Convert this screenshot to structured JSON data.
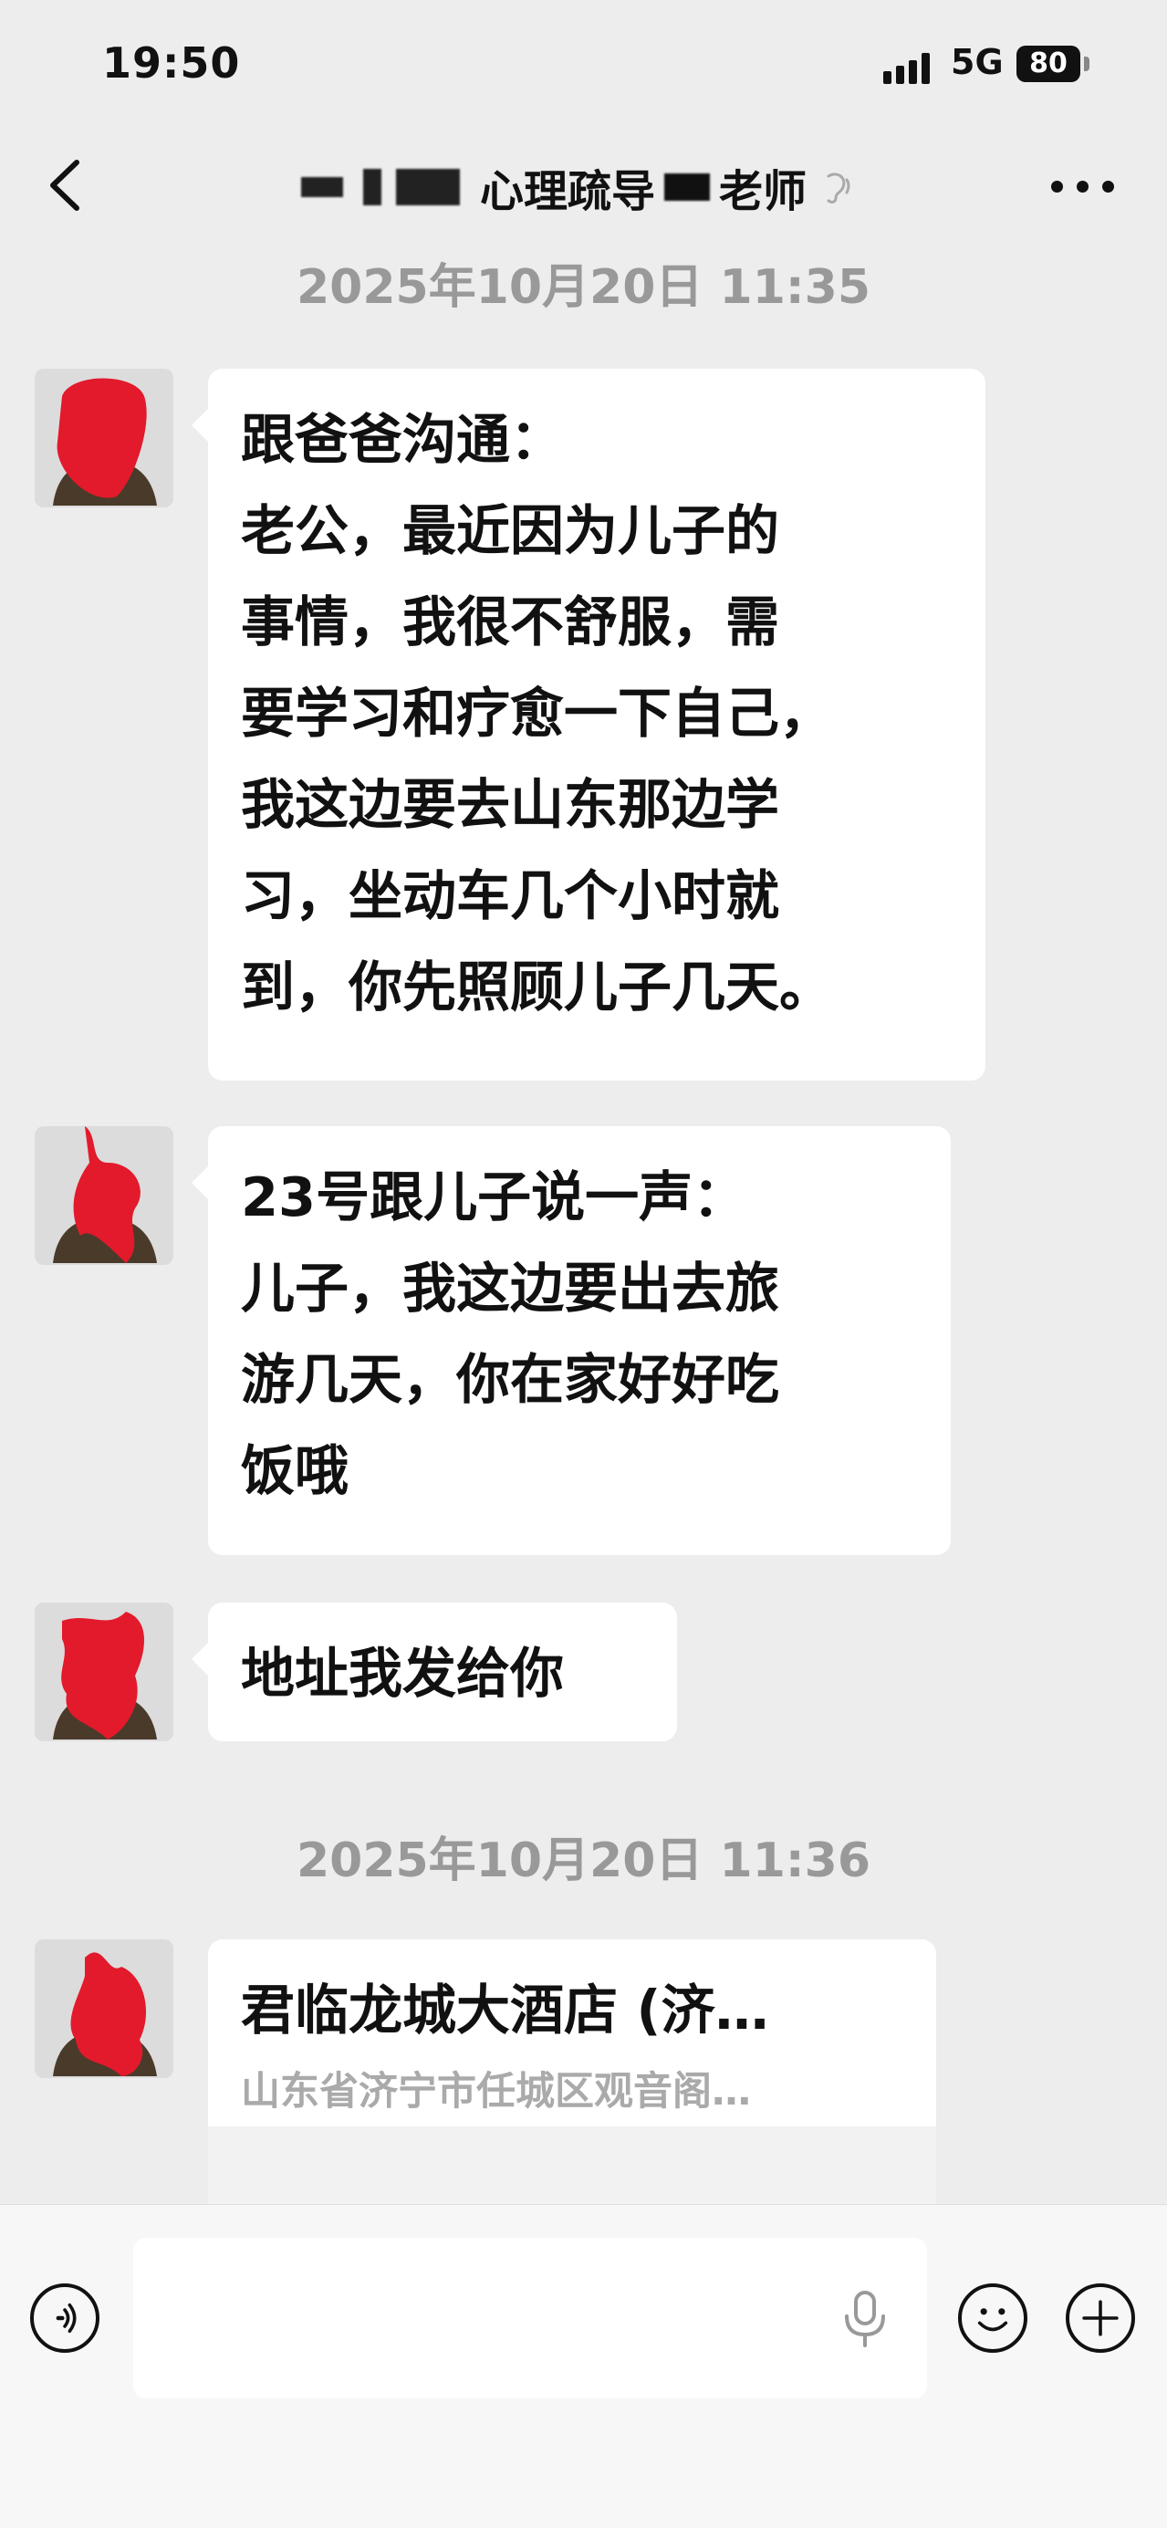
{
  "status_bar": {
    "time": "19:50",
    "network": "5G",
    "battery": "80"
  },
  "nav": {
    "title_prefix": "心理疏导",
    "title_suffix": "老师"
  },
  "messages": [
    {
      "type": "timestamp",
      "text": "2025年10月20日 11:35"
    },
    {
      "type": "text",
      "lines": [
        "跟爸爸沟通：",
        "老公，最近因为儿子的",
        "事情，我很不舒服，需",
        "要学习和疗愈一下自己，",
        "我这边要去山东那边学",
        "习，坐动车几个小时就",
        "到，你先照顾儿子几天。"
      ]
    },
    {
      "type": "text",
      "lines": [
        "23号跟儿子说一声：",
        "儿子，我这边要出去旅",
        "游几天，你在家好好吃",
        "饭哦"
      ]
    },
    {
      "type": "text",
      "lines": [
        "地址我发给你"
      ]
    },
    {
      "type": "timestamp",
      "text": "2025年10月20日 11:36"
    },
    {
      "type": "location",
      "name": "君临龙城大酒店 (济…",
      "address": "山东省济宁市任城区观音阁…"
    }
  ],
  "input_bar": {
    "placeholder": ""
  },
  "icons": {
    "back": "chevron-left-icon",
    "more": "more-dots-icon",
    "voice": "voice-toggle-icon",
    "mic": "microphone-icon",
    "emoji": "emoji-icon",
    "plus": "plus-icon",
    "earpiece": "earpiece-icon"
  }
}
